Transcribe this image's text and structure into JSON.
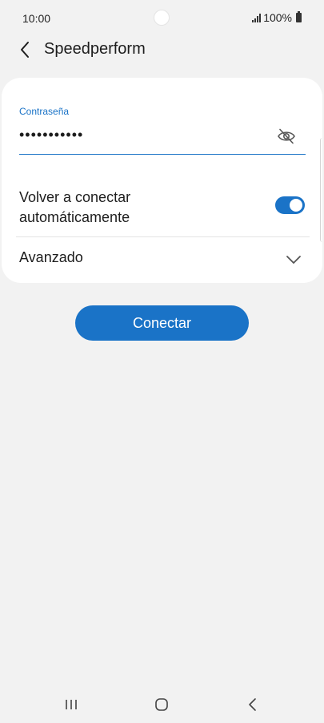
{
  "status_bar": {
    "time": "10:00",
    "battery": "100%",
    "icons": [
      "signal-icon",
      "battery-icon"
    ]
  },
  "header": {
    "title": "Speedperform",
    "back_icon": "back-arrow-icon"
  },
  "password": {
    "label": "Contraseña",
    "value": "•••••••••••",
    "visibility_icon": "eye-off-icon"
  },
  "auto_reconnect": {
    "label": "Volver a conectar automáticamente",
    "enabled": true
  },
  "advanced": {
    "label": "Avanzado",
    "icon": "chevron-down-icon"
  },
  "connect_label": "Conectar",
  "colors": {
    "accent": "#1a73c7",
    "background": "#f2f2f2",
    "card": "#ffffff"
  },
  "nav_bar": {
    "icons": [
      "recents-icon",
      "home-icon",
      "nav-back-icon"
    ]
  }
}
